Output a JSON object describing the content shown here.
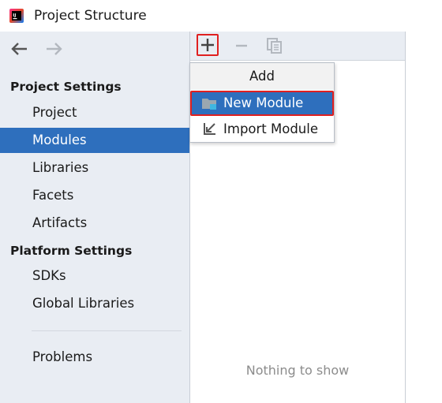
{
  "window": {
    "title": "Project Structure",
    "icon": "intellij-idea-icon"
  },
  "navigation": {
    "back_icon": "arrow-left-icon",
    "forward_icon": "arrow-right-icon"
  },
  "sidebar": {
    "project_settings_header": "Project Settings",
    "project_items": [
      "Project",
      "Modules",
      "Libraries",
      "Facets",
      "Artifacts"
    ],
    "selected_item": "Modules",
    "platform_settings_header": "Platform Settings",
    "platform_items": [
      "SDKs",
      "Global Libraries"
    ],
    "problems_label": "Problems"
  },
  "toolbar": {
    "add_icon": "plus-icon",
    "remove_icon": "minus-icon",
    "copy_icon": "copy-icon"
  },
  "list": {
    "empty_text": "Nothing to show"
  },
  "popup": {
    "header": "Add",
    "items": [
      {
        "label": "New Module",
        "icon": "folder-module-icon",
        "highlighted": true
      },
      {
        "label": "Import Module",
        "icon": "import-arrow-icon",
        "highlighted": false
      }
    ]
  },
  "colors": {
    "selection": "#2e6fbd",
    "sidebar_bg": "#e9edf3",
    "highlight_border": "#e02020"
  }
}
